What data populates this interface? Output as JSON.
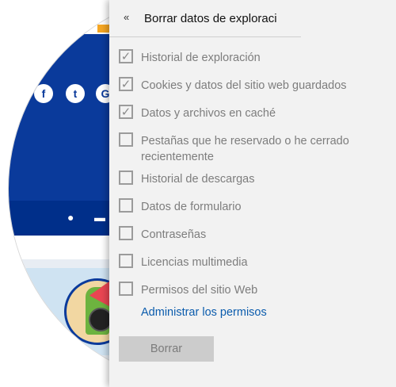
{
  "panel": {
    "title": "Borrar datos de exploraci",
    "back_glyph": "«",
    "options": [
      {
        "label": "Historial de exploración",
        "checked": true
      },
      {
        "label": "Cookies y datos del sitio web guardados",
        "checked": true
      },
      {
        "label": "Datos y archivos en caché",
        "checked": true
      },
      {
        "label": "Pestañas que he reservado o he cerrado recientemente",
        "checked": false
      },
      {
        "label": "Historial de descargas",
        "checked": false
      },
      {
        "label": "Datos de formulario",
        "checked": false
      },
      {
        "label": "Contraseñas",
        "checked": false
      },
      {
        "label": "Licencias multimedia",
        "checked": false
      },
      {
        "label": "Permisos del sitio Web",
        "checked": false
      }
    ],
    "manage_link": "Administrar los permisos",
    "clear_button": "Borrar"
  },
  "background": {
    "social": [
      "f",
      "t",
      "G"
    ],
    "colors": {
      "hero": "#0a3a9b",
      "accent": "#f5a623",
      "arrow": "#e94552"
    }
  }
}
